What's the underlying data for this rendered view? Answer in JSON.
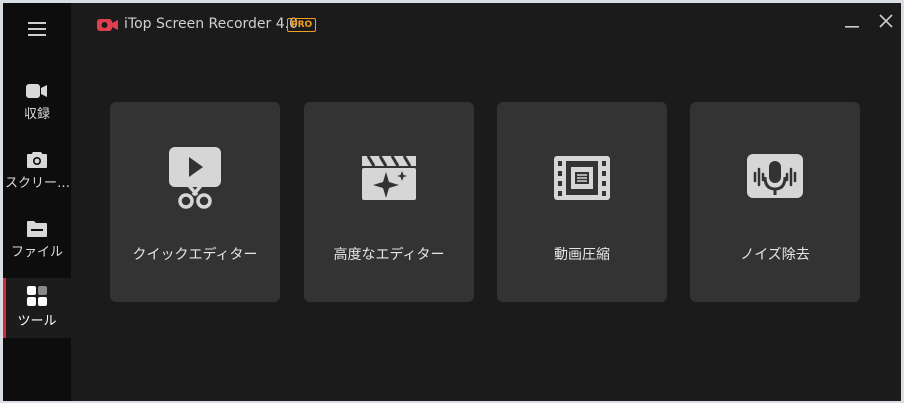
{
  "app": {
    "title": "iTop Screen Recorder 4.0",
    "badge": "PRO",
    "accent": "#d42a3a",
    "badge_color": "#f0a020"
  },
  "sidebar": {
    "menu_icon": "hamburger-icon",
    "items": [
      {
        "label": "収録",
        "icon": "camera-icon",
        "active": false
      },
      {
        "label": "スクリー…",
        "icon": "screenshot-icon",
        "active": false
      },
      {
        "label": "ファイル",
        "icon": "folder-icon",
        "active": false
      },
      {
        "label": "ツール",
        "icon": "tools-grid-icon",
        "active": true
      }
    ]
  },
  "window_controls": {
    "minimize_icon": "minimize-icon",
    "close_icon": "close-icon"
  },
  "tools": [
    {
      "label": "クイックエディター",
      "icon": "video-scissors-icon"
    },
    {
      "label": "高度なエディター",
      "icon": "clapperboard-sparkle-icon"
    },
    {
      "label": "動画圧縮",
      "icon": "film-compress-icon"
    },
    {
      "label": "ノイズ除去",
      "icon": "mic-waveform-icon"
    }
  ]
}
